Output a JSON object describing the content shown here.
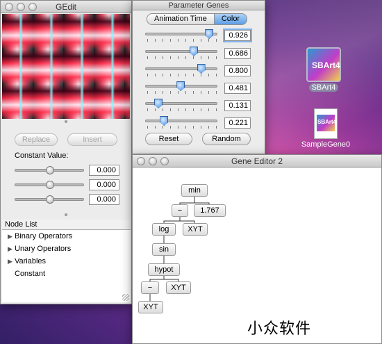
{
  "gedit": {
    "title": "GEdit",
    "replace_label": "Replace",
    "insert_label": "Insert",
    "constant_label": "Constant Value:",
    "constants": [
      "0.000",
      "0.000",
      "0.000"
    ],
    "constant_levels": [
      0.5,
      0.5,
      0.5
    ],
    "nodelist_header": "Node List",
    "nodelist": [
      {
        "label": "Binary Operators",
        "expandable": true
      },
      {
        "label": "Unary Operators",
        "expandable": true
      },
      {
        "label": "Variables",
        "expandable": true
      },
      {
        "label": "Constant",
        "expandable": false
      }
    ]
  },
  "params": {
    "title": "Parameter Genes",
    "tab_animation": "Animation Time",
    "tab_color": "Color",
    "values": [
      "0.926",
      "0.686",
      "0.800",
      "0.481",
      "0.131",
      "0.221"
    ],
    "levels": [
      0.926,
      0.686,
      0.8,
      0.481,
      0.131,
      0.221
    ],
    "reset_label": "Reset",
    "random_label": "Random"
  },
  "gene_editor": {
    "title": "Gene Editor 2",
    "nodes": [
      "min",
      "−",
      "1.767",
      "log",
      "XYT",
      "sin",
      "hypot",
      "−",
      "XYT",
      "XYT"
    ]
  },
  "desktop": {
    "icon1_label": "SBArt4",
    "icon1_art": "SBArt4",
    "icon2_label": "SampleGene0",
    "icon2_art": "SBArt4"
  },
  "watermark": "小众软件"
}
